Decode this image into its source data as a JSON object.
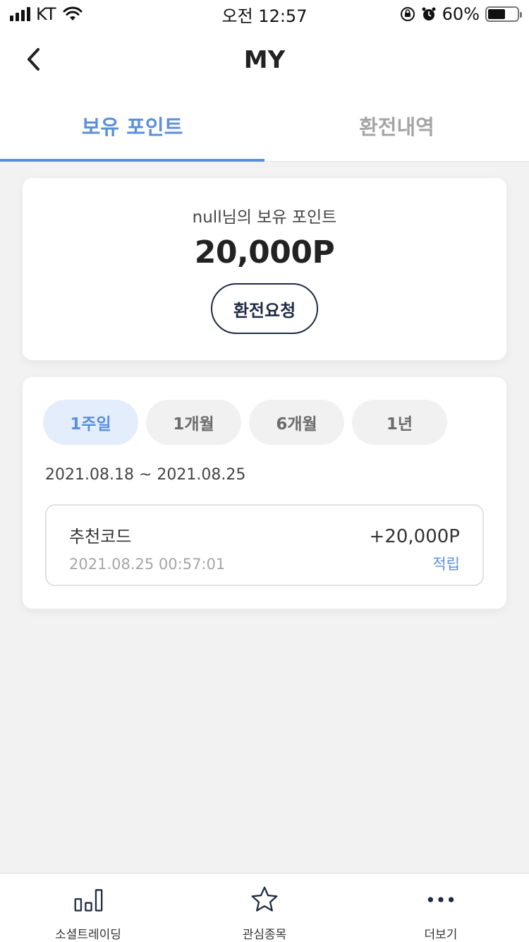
{
  "status": {
    "carrier": "KT",
    "time": "오전 12:57",
    "battery": "60%"
  },
  "navbar": {
    "title": "MY"
  },
  "tabs": [
    {
      "label": "보유 포인트"
    },
    {
      "label": "환전내역"
    }
  ],
  "points": {
    "label": "null님의 보유 포인트",
    "value": "20,000P",
    "button": "환전요청"
  },
  "periods": [
    {
      "label": "1주일"
    },
    {
      "label": "1개월"
    },
    {
      "label": "6개월"
    },
    {
      "label": "1년"
    }
  ],
  "range": "2021.08.18 ~ 2021.08.25",
  "entries": [
    {
      "name": "추천코드",
      "date": "2021.08.25 00:57:01",
      "amount": "+20,000P",
      "type": "적립"
    }
  ],
  "tabbar": [
    {
      "label": "소셜트레이딩"
    },
    {
      "label": "관심종목"
    },
    {
      "label": "더보기"
    }
  ],
  "colors": {
    "accent": "#5b8fdc",
    "dark": "#1f2a44"
  }
}
